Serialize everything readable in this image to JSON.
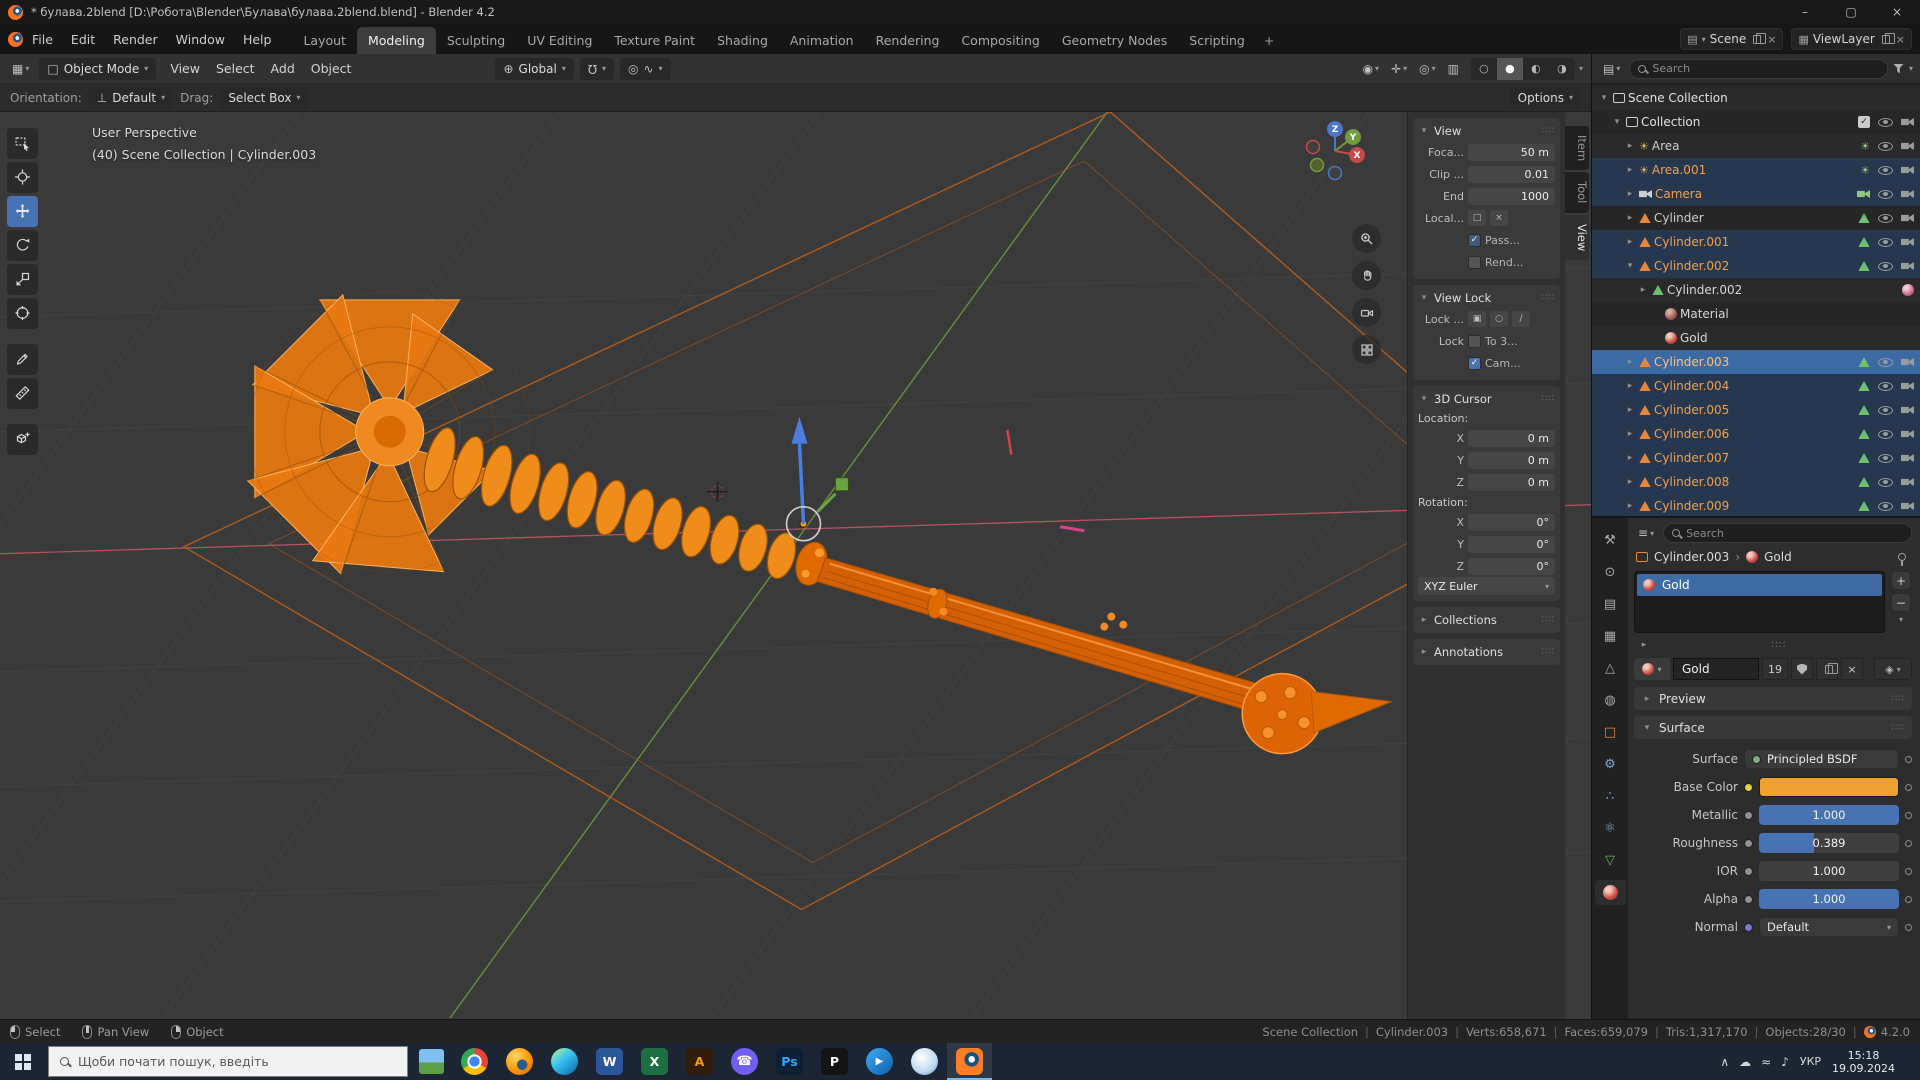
{
  "titlebar": {
    "title": "* булава.2blend [D:\\Робота\\Blender\\Булава\\булава.2blend.blend] - Blender 4.2",
    "minimize": "–",
    "maximize": "▢",
    "close": "×"
  },
  "topbar": {
    "menus": [
      "File",
      "Edit",
      "Render",
      "Window",
      "Help"
    ],
    "workspaces": [
      "Layout",
      "Modeling",
      "Sculpting",
      "UV Editing",
      "Texture Paint",
      "Shading",
      "Animation",
      "Rendering",
      "Compositing",
      "Geometry Nodes",
      "Scripting"
    ],
    "active_workspace": "Modeling",
    "add_tab": "+",
    "scene_label": "Scene",
    "viewlayer_label": "ViewLayer"
  },
  "viewport_header": {
    "mode_label": "Object Mode",
    "menus": [
      "View",
      "Select",
      "Add",
      "Object"
    ],
    "orientation_label": "Global"
  },
  "tool_settings": {
    "orientation_label": "Orientation:",
    "orientation_value": "Default",
    "drag_label": "Drag:",
    "drag_value": "Select Box",
    "options_label": "Options"
  },
  "toolbar": {
    "tools": [
      {
        "name": "select-box",
        "active": false
      },
      {
        "name": "cursor",
        "active": false
      },
      {
        "name": "move",
        "active": true
      },
      {
        "name": "rotate",
        "active": false
      },
      {
        "name": "scale",
        "active": false
      },
      {
        "name": "transform",
        "active": false
      },
      {
        "name": "annotate",
        "active": false,
        "group": true
      },
      {
        "name": "measure",
        "active": false
      },
      {
        "name": "add-cube",
        "active": false,
        "group": true
      }
    ]
  },
  "viewport": {
    "overlay_line1": "User Perspective",
    "overlay_line2": "(40) Scene Collection | Cylinder.003",
    "gizmo_labels": [
      "Z",
      "Y",
      "X"
    ],
    "nav_buttons": [
      "zoom",
      "pan",
      "camera-view",
      "grid-toggle"
    ]
  },
  "sidebar": {
    "tabs": [
      {
        "label": "Item",
        "active": false
      },
      {
        "label": "Tool",
        "active": false
      },
      {
        "label": "View",
        "active": true
      }
    ],
    "panels": {
      "view": {
        "title": "View",
        "rows": [
          {
            "type": "field",
            "label": "Foca...",
            "value": "50 m"
          },
          {
            "type": "field",
            "label": "Clip ...",
            "value": "0.01"
          },
          {
            "type": "field",
            "label": "End",
            "value": "1000"
          },
          {
            "type": "objfield",
            "label": "Local..."
          },
          {
            "type": "check",
            "label": "",
            "text": "Pass...",
            "checked": true,
            "dim": true
          },
          {
            "type": "check",
            "label": "",
            "text": "Rend...",
            "checked": false
          }
        ]
      },
      "view_lock": {
        "title": "View Lock",
        "rows": [
          {
            "type": "lockfield",
            "label": "Lock ..."
          },
          {
            "type": "check",
            "label": "Lock",
            "text": "To 3...",
            "checked": false
          },
          {
            "type": "check",
            "label": "",
            "text": "Cam...",
            "checked": true
          }
        ]
      },
      "cursor": {
        "title": "3D Cursor",
        "location_label": "Location:",
        "location": [
          {
            "axis": "X",
            "value": "0 m"
          },
          {
            "axis": "Y",
            "value": "0 m"
          },
          {
            "axis": "Z",
            "value": "0 m"
          }
        ],
        "rotation_label": "Rotation:",
        "rotation": [
          {
            "axis": "X",
            "value": "0°"
          },
          {
            "axis": "Y",
            "value": "0°"
          },
          {
            "axis": "Z",
            "value": "0°"
          }
        ],
        "order": "XYZ Euler"
      },
      "collections": {
        "title": "Collections"
      },
      "annotations": {
        "title": "Annotations"
      }
    }
  },
  "outliner": {
    "search_placeholder": "Search",
    "rows": [
      {
        "indent": 0,
        "exp": "▾",
        "icon": "scene",
        "label": "Scene Collection",
        "sel": "none",
        "fg": "#e2e2e2",
        "right": []
      },
      {
        "indent": 1,
        "exp": "▾",
        "icon": "collection",
        "label": "Collection",
        "sel": "none",
        "fg": "#e2e2e2",
        "right": [
          "check",
          "eye",
          "cam"
        ]
      },
      {
        "indent": 2,
        "exp": "▸",
        "icon": "light",
        "label": "Area",
        "sel": "none",
        "fg": "#cfcfcf",
        "right": [
          "dlight",
          "eye",
          "cam"
        ]
      },
      {
        "indent": 2,
        "exp": "▸",
        "icon": "light",
        "label": "Area.001",
        "sel": "sel",
        "fg": "#f0a050",
        "right": [
          "dlight",
          "eye",
          "cam"
        ]
      },
      {
        "indent": 2,
        "exp": "▸",
        "icon": "camera",
        "label": "Camera",
        "sel": "sel",
        "fg": "#f0a050",
        "right": [
          "dcam",
          "eye",
          "cam"
        ]
      },
      {
        "indent": 2,
        "exp": "▸",
        "icon": "mesh",
        "label": "Cylinder",
        "sel": "none",
        "fg": "#cfcfcf",
        "right": [
          "dmesh",
          "eye",
          "cam"
        ]
      },
      {
        "indent": 2,
        "exp": "▸",
        "icon": "mesh",
        "label": "Cylinder.001",
        "sel": "sel",
        "fg": "#f0a050",
        "right": [
          "dmesh",
          "eye",
          "cam"
        ]
      },
      {
        "indent": 2,
        "exp": "▾",
        "icon": "mesh",
        "label": "Cylinder.002",
        "sel": "sel",
        "fg": "#f0a050",
        "right": [
          "dmesh",
          "eye",
          "cam"
        ]
      },
      {
        "indent": 3,
        "exp": "▸",
        "icon": "dmesh",
        "label": "Cylinder.002",
        "sel": "none",
        "fg": "#d8d8d8",
        "right": [
          "msphere"
        ]
      },
      {
        "indent": 4,
        "exp": "",
        "icon": "matslot",
        "label": "Material",
        "sel": "none",
        "fg": "#d8d8d8",
        "right": []
      },
      {
        "indent": 4,
        "exp": "",
        "icon": "material",
        "label": "Gold",
        "sel": "none",
        "fg": "#d8d8d8",
        "right": []
      },
      {
        "indent": 2,
        "exp": "▸",
        "icon": "mesh",
        "label": "Cylinder.003",
        "sel": "active",
        "fg": "#ffc27a",
        "right": [
          "dmesh",
          "eye",
          "cam"
        ]
      },
      {
        "indent": 2,
        "exp": "▸",
        "icon": "mesh",
        "label": "Cylinder.004",
        "sel": "sel",
        "fg": "#f0a050",
        "right": [
          "dmesh",
          "eye",
          "cam"
        ]
      },
      {
        "indent": 2,
        "exp": "▸",
        "icon": "mesh",
        "label": "Cylinder.005",
        "sel": "sel",
        "fg": "#f0a050",
        "right": [
          "dmesh",
          "eye",
          "cam"
        ]
      },
      {
        "indent": 2,
        "exp": "▸",
        "icon": "mesh",
        "label": "Cylinder.006",
        "sel": "sel",
        "fg": "#f0a050",
        "right": [
          "dmesh",
          "eye",
          "cam"
        ]
      },
      {
        "indent": 2,
        "exp": "▸",
        "icon": "mesh",
        "label": "Cylinder.007",
        "sel": "sel",
        "fg": "#f0a050",
        "right": [
          "dmesh",
          "eye",
          "cam"
        ]
      },
      {
        "indent": 2,
        "exp": "▸",
        "icon": "mesh",
        "label": "Cylinder.008",
        "sel": "sel",
        "fg": "#f0a050",
        "right": [
          "dmesh",
          "eye",
          "cam"
        ]
      },
      {
        "indent": 2,
        "exp": "▸",
        "icon": "mesh",
        "label": "Cylinder.009",
        "sel": "sel",
        "fg": "#f0a050",
        "right": [
          "dmesh",
          "eye",
          "cam"
        ]
      }
    ]
  },
  "properties": {
    "search_placeholder": "Search",
    "breadcrumb": {
      "object": "Cylinder.003",
      "material": "Gold"
    },
    "slot": {
      "name": "Gold"
    },
    "datablock": {
      "name": "Gold",
      "users": "19"
    },
    "panels": {
      "preview": "Preview",
      "surface": "Surface"
    },
    "tabs": [
      {
        "name": "tool",
        "glyph": "⚒",
        "color": "#a8a8a8",
        "active": false
      },
      {
        "name": "render",
        "glyph": "⊙",
        "color": "#a8a8a8",
        "active": false
      },
      {
        "name": "output",
        "glyph": "▤",
        "color": "#a8a8a8",
        "active": false
      },
      {
        "name": "view-layer",
        "glyph": "▦",
        "color": "#a8a8a8",
        "active": false
      },
      {
        "name": "scene",
        "glyph": "△",
        "color": "#a8a8a8",
        "active": false
      },
      {
        "name": "world",
        "glyph": "◍",
        "color": "#a8a8a8",
        "active": false
      },
      {
        "name": "object",
        "glyph": "□",
        "color": "#e8873c",
        "active": false
      },
      {
        "name": "modifiers",
        "glyph": "⚙",
        "color": "#7ca7d8",
        "active": false
      },
      {
        "name": "particles",
        "glyph": "∴",
        "color": "#7ca7d8",
        "active": false
      },
      {
        "name": "physics",
        "glyph": "⚛",
        "color": "#7ca7d8",
        "active": false
      },
      {
        "name": "object-data",
        "glyph": "▽",
        "color": "#69b05c",
        "active": false
      },
      {
        "name": "material",
        "glyph": "",
        "color": "#cc4b42",
        "active": true
      }
    ],
    "surface": {
      "rows": [
        {
          "label": "Surface",
          "type": "shader",
          "value": "Principled BSDF",
          "dot": "#7fae7f"
        },
        {
          "label": "Base Color",
          "type": "color",
          "socket": "#e6d23c",
          "value": "#efa132"
        },
        {
          "label": "Metallic",
          "type": "slider",
          "socket": "#909090",
          "value": "1.000",
          "fill": 1.0
        },
        {
          "label": "Roughness",
          "type": "slider",
          "socket": "#909090",
          "value": "0.389",
          "fill": 0.39
        },
        {
          "label": "IOR",
          "type": "slider",
          "socket": "#909090",
          "value": "1.000",
          "fill": 0.0
        },
        {
          "label": "Alpha",
          "type": "slider",
          "socket": "#909090",
          "value": "1.000",
          "fill": 1.0
        },
        {
          "label": "Normal",
          "type": "dropdown",
          "socket": "#7a7ad0",
          "value": "Default"
        }
      ]
    }
  },
  "statusbar": {
    "hints": [
      {
        "button": "left",
        "label": "Select"
      },
      {
        "button": "middle",
        "label": "Pan View"
      },
      {
        "button": "right",
        "label": "Object"
      }
    ],
    "stats": [
      "Scene Collection",
      "Cylinder.003",
      "Verts:658,671",
      "Faces:659,079",
      "Tris:1,317,170",
      "Objects:28/30"
    ],
    "version": "4.2.0"
  },
  "taskbar": {
    "search_placeholder": "Щоби почати пошук, введіть",
    "apps": [
      {
        "name": "chrome",
        "label": ""
      },
      {
        "name": "firefox",
        "label": ""
      },
      {
        "name": "edge",
        "label": ""
      },
      {
        "name": "word",
        "label": "W"
      },
      {
        "name": "excel",
        "label": "X"
      },
      {
        "name": "illustrator",
        "label": "A"
      },
      {
        "name": "viber",
        "label": "☎"
      },
      {
        "name": "photoshop",
        "label": "Ps"
      },
      {
        "name": "pen-tablet",
        "label": "P"
      },
      {
        "name": "media-player",
        "label": "▶"
      },
      {
        "name": "video-app",
        "label": ""
      },
      {
        "name": "blender",
        "label": "",
        "active": true
      }
    ],
    "tray_icons": [
      {
        "name": "expand",
        "glyph": "∧"
      },
      {
        "name": "cloud",
        "glyph": "☁"
      },
      {
        "name": "network",
        "glyph": "≈"
      },
      {
        "name": "volume",
        "glyph": "♪"
      }
    ],
    "tray": {
      "language": "УКР",
      "time": "15:18",
      "date": "19.09.2024"
    }
  },
  "colors": {
    "accent": "#4772b3",
    "selected_row": "#26384f",
    "active_row": "#3b6aa5",
    "object_name_orange": "#f0a050",
    "mace_orange": "#f08c1a",
    "base_color_gold": "#efa132"
  }
}
